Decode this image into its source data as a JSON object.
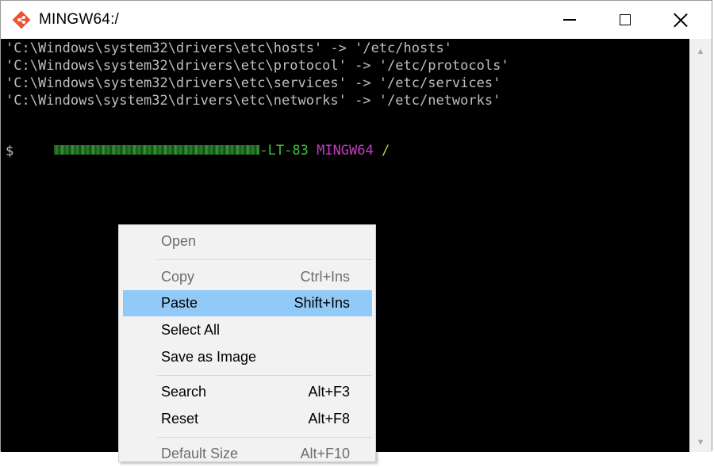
{
  "window": {
    "title": "MINGW64:/"
  },
  "terminal": {
    "lines": [
      "'C:\\Windows\\system32\\drivers\\etc\\hosts' -> '/etc/hosts'",
      "'C:\\Windows\\system32\\drivers\\etc\\protocol' -> '/etc/protocols'",
      "'C:\\Windows\\system32\\drivers\\etc\\services' -> '/etc/services'",
      "'C:\\Windows\\system32\\drivers\\etc\\networks' -> '/etc/networks'"
    ],
    "prompt": {
      "host_suffix": "-LT-83",
      "system": "MINGW64",
      "path": "/"
    },
    "cursor_symbol": "$"
  },
  "context_menu": {
    "items": [
      {
        "label": "Open",
        "shortcut": "",
        "disabled": true
      },
      {
        "label": "Copy",
        "shortcut": "Ctrl+Ins",
        "disabled": true
      },
      {
        "label": "Paste",
        "shortcut": "Shift+Ins",
        "highlighted": true
      },
      {
        "label": "Select All",
        "shortcut": ""
      },
      {
        "label": "Save as Image",
        "shortcut": ""
      },
      {
        "label": "Search",
        "shortcut": "Alt+F3"
      },
      {
        "label": "Reset",
        "shortcut": "Alt+F8"
      },
      {
        "label": "Default Size",
        "shortcut": "Alt+F10",
        "disabled": true
      }
    ]
  },
  "colors": {
    "terminal_bg": "#000000",
    "terminal_text": "#bfbfbf",
    "prompt_host": "#3fbf3f",
    "prompt_system": "#c03ec0",
    "prompt_path": "#c8c83a",
    "menu_highlight": "#91c9f7"
  },
  "icons": [
    "git-icon",
    "minimize-icon",
    "maximize-icon",
    "close-icon",
    "scroll-up-arrow-icon",
    "scroll-down-arrow-icon"
  ]
}
